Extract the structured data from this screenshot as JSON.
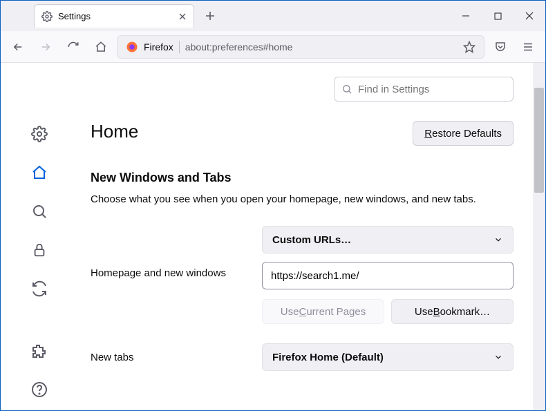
{
  "browser": {
    "tab_title": "Settings",
    "urlbar_label": "Firefox",
    "url": "about:preferences#home"
  },
  "search": {
    "placeholder": "Find in Settings"
  },
  "page": {
    "title": "Home",
    "restore_button": "Restore Defaults",
    "restore_accel": "R"
  },
  "section": {
    "title": "New Windows and Tabs",
    "desc": "Choose what you see when you open your homepage, new windows, and new tabs."
  },
  "homepage": {
    "label": "Homepage and new windows",
    "dropdown": "Custom URLs…",
    "url_value": "https://search1.me/",
    "use_current": "Use Current Pages",
    "use_current_accel": "C",
    "use_bookmark": "Use Bookmark…",
    "use_bookmark_accel": "B"
  },
  "newtabs": {
    "label": "New tabs",
    "dropdown": "Firefox Home (Default)"
  }
}
